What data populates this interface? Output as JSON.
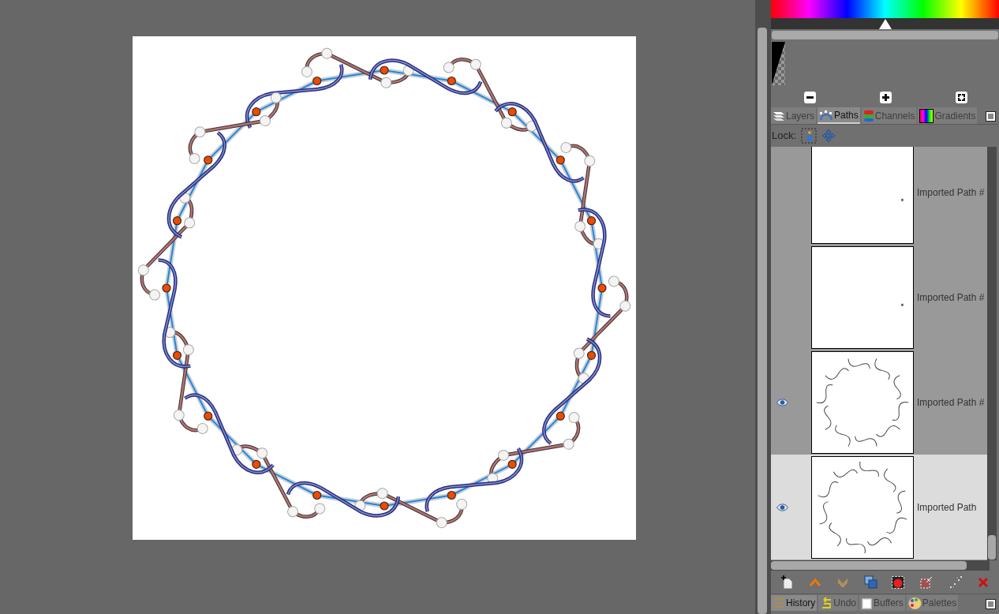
{
  "color_selector": {
    "hue_slider": {
      "level": 0.5
    }
  },
  "dock_tabs": [
    {
      "label": "Layers",
      "selected": false
    },
    {
      "label": "Paths",
      "selected": true
    },
    {
      "label": "Channels",
      "selected": false
    },
    {
      "label": "Gradients",
      "selected": false
    }
  ],
  "lock": {
    "label": "Lock:"
  },
  "paths": [
    {
      "name": "Imported Path #",
      "visible": false,
      "selected": false,
      "kind": "dot"
    },
    {
      "name": "Imported Path #",
      "visible": false,
      "selected": false,
      "kind": "dot"
    },
    {
      "name": "Imported Path #",
      "visible": true,
      "selected": false,
      "kind": "ring"
    },
    {
      "name": "Imported Path",
      "visible": true,
      "selected": true,
      "kind": "ring"
    }
  ],
  "bottom_dock_tabs": [
    {
      "label": "History",
      "selected": true
    },
    {
      "label": "Undo",
      "selected": false
    },
    {
      "label": "Buffers",
      "selected": false
    },
    {
      "label": "Palettes",
      "selected": false
    }
  ]
}
